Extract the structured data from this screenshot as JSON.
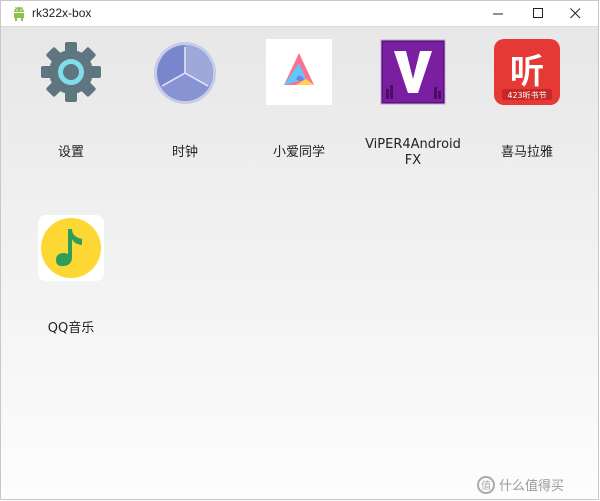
{
  "window": {
    "title": "rk322x-box",
    "icon": "android-icon"
  },
  "apps": [
    {
      "label": "设置",
      "icon": "settings-gear-icon"
    },
    {
      "label": "时钟",
      "icon": "clock-icon"
    },
    {
      "label": "小爱同学",
      "icon": "xiaoai-assistant-icon"
    },
    {
      "label": "ViPER4Android FX",
      "label_line1": "ViPER4Android",
      "label_line2": "FX",
      "icon": "viper4android-icon"
    },
    {
      "label": "喜马拉雅",
      "icon": "ximalaya-icon"
    },
    {
      "label": "QQ音乐",
      "icon": "qq-music-icon"
    }
  ],
  "ximalaya_badge": "听",
  "ximalaya_caption": "423听书节",
  "watermark": {
    "icon_char": "值",
    "text": "什么值得买"
  },
  "colors": {
    "android_green": "#8bc34a",
    "viper_purple": "#6a1b9a",
    "ximalaya_red": "#e53935",
    "qq_yellow": "#fdd835",
    "qq_green": "#2e9e5b"
  }
}
